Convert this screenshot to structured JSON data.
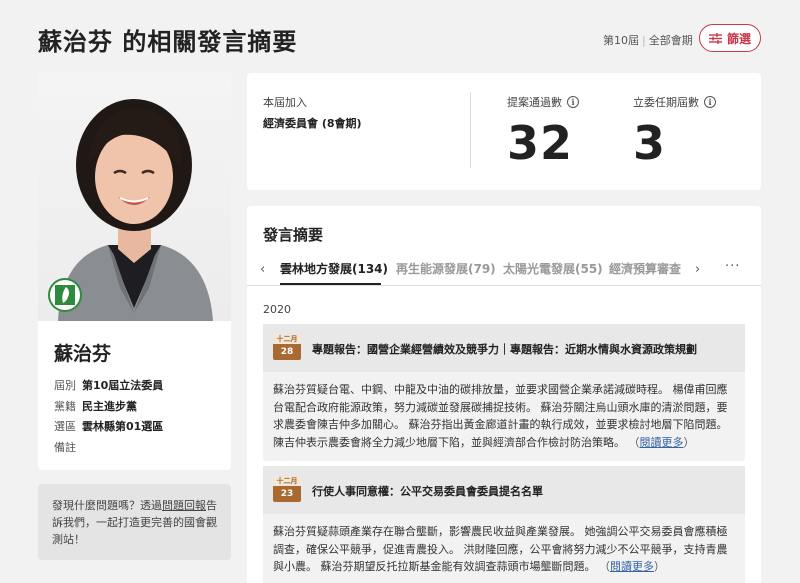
{
  "header": {
    "title": "蘇治芬 的相關發言摘要",
    "term": "第10屆",
    "session": "全部會期",
    "filter_label": "篩選"
  },
  "profile": {
    "name": "蘇治芬",
    "rows": [
      {
        "key": "屆別",
        "value": "第10屆立法委員"
      },
      {
        "key": "黨籍",
        "value": "民主進步黨"
      },
      {
        "key": "選區",
        "value": "雲林縣第01選區"
      },
      {
        "key": "備註",
        "value": ""
      }
    ]
  },
  "report": {
    "text_before": "發現什麼問題嗎？透過",
    "link": "問題回報",
    "text_after": "告訴我們，一起打造更完善的國會觀測站！"
  },
  "stats": {
    "join_label": "本屆加入",
    "join_value": "經濟委員會 (8會期)",
    "proposals_label": "提案通過數",
    "proposals_value": "32",
    "terms_label": "立委任期屆數",
    "terms_value": "3"
  },
  "summary": {
    "title": "發言摘要",
    "tabs": [
      {
        "label": "雲林地方發展(134)"
      },
      {
        "label": "再生能源發展(79)"
      },
      {
        "label": "太陽光電發展(55)"
      },
      {
        "label": "經濟預算審查("
      }
    ],
    "more": "···",
    "year": "2020",
    "entries": [
      {
        "month": "十二月",
        "day": "28",
        "title": "專題報告：國營企業經營績效及競爭力｜專題報告：近期水情與水資源政策規劃",
        "body": "蘇治芬質疑台電、中鋼、中龍及中油的碳排放量，並要求國營企業承諾減碳時程。 楊偉甫回應台電配合政府能源政策，努力減碳並發展碳捕捉技術。 蘇治芬關注烏山頭水庫的清淤問題，要求農委會陳吉仲多加關心。 蘇治芬指出黃金廊道計畫的執行成效，並要求檢討地層下陷問題。 陳吉仲表示農委會將全力減少地層下陷，並與經濟部合作檢討防治策略。",
        "read_more": "閱讀更多"
      },
      {
        "month": "十二月",
        "day": "23",
        "title": "行使人事同意權：公平交易委員會委員提名名單",
        "body": "蘇治芬質疑蒜頭產業存在聯合壟斷，影響農民收益與產業發展。 她強調公平交易委員會應積極調查，確保公平競爭，促進青農投入。 洪財隆回應，公平會將努力減少不公平競爭，支持青農與小農。 蘇治芬期望反托拉斯基金能有效調查蒜頭市場壟斷問題。",
        "read_more": "閱讀更多"
      }
    ]
  },
  "colors": {
    "accent": "#c8384a",
    "badge_brown": "#a86a31",
    "link_blue": "#3563a8",
    "party_green": "#2e8b3e"
  }
}
